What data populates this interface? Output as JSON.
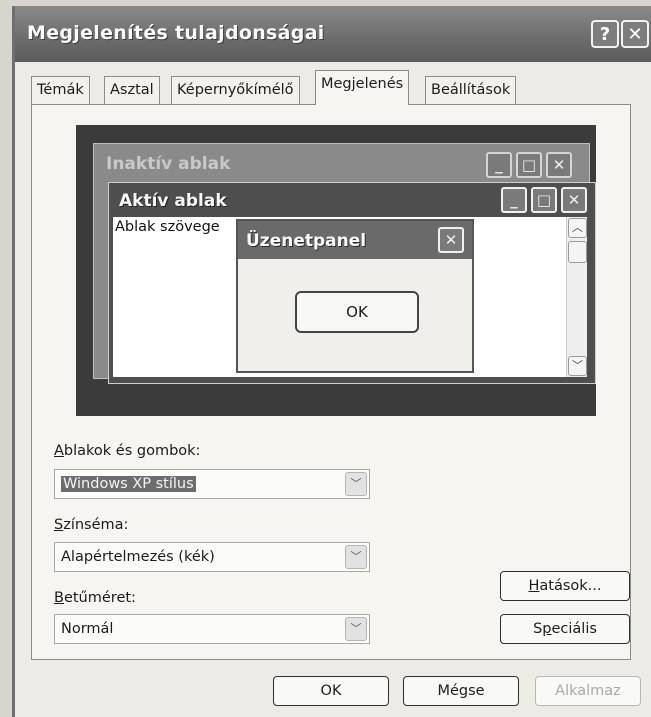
{
  "window": {
    "title": "Megjelenítés tulajdonságai",
    "help_glyph": "?",
    "close_glyph": "✕"
  },
  "tabs": [
    {
      "label": "Témák",
      "active": false
    },
    {
      "label": "Asztal",
      "active": false
    },
    {
      "label": "Képernyőkímélő",
      "active": false
    },
    {
      "label": "Megjelenés",
      "active": true
    },
    {
      "label": "Beállítások",
      "active": false
    }
  ],
  "preview": {
    "inactive_title": "Inaktív ablak",
    "active_title": "Aktív ablak",
    "window_text": "Ablak szövege",
    "message_title": "Üzenetpanel",
    "message_ok": "OK",
    "minimize_glyph": "_",
    "maximize_glyph": "□",
    "close_glyph": "✕",
    "scroll_up_glyph": "︿",
    "scroll_down_glyph": "﹀"
  },
  "fields": {
    "windows_buttons": {
      "label_accel": "A",
      "label_rest": "blakok és gombok:",
      "value": "Windows XP stílus"
    },
    "color_scheme": {
      "label_accel": "S",
      "label_rest": "zínséma:",
      "value": "Alapértelmezés (kék)"
    },
    "font_size": {
      "label_accel": "B",
      "label_rest": "etűméret:",
      "value": "Normál"
    },
    "dropdown_glyph": "﹀"
  },
  "buttons": {
    "effects_accel": "H",
    "effects_rest": "atások...",
    "advanced_pre": "S",
    "advanced_accel": "p",
    "advanced_rest": "eciális",
    "ok": "OK",
    "cancel": "Mégse",
    "apply": "Alkalmaz"
  },
  "colors": {
    "titlebar": "#6b6b6b",
    "panel_bg": "#f6f5f1",
    "preview_bg": "#3b3b3b"
  }
}
